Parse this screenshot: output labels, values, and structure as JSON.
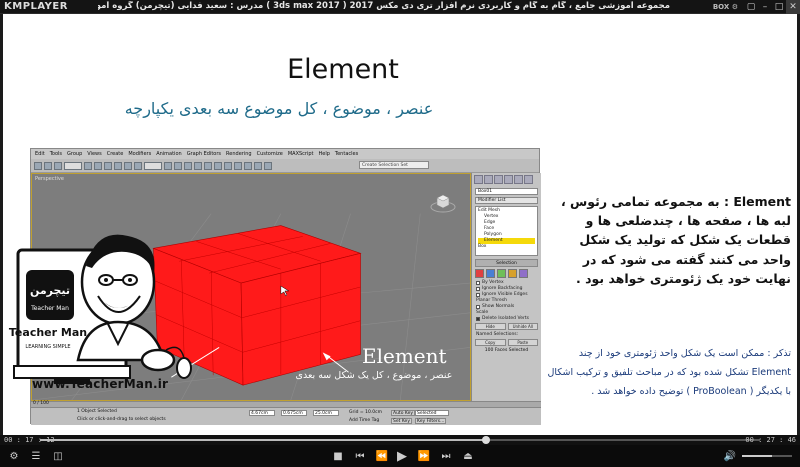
{
  "player": {
    "logo": "KMPLAYER",
    "title": "مجموعه آموزشی جامع ، گام به گام و کاربردی نرم افزار تری دی مکس 2017  ( 3ds max 2017 )  مدرس : سعید فدایی (تیچرمن) گروه آموزشی پادشاه گرافیست ها",
    "box_label": "BOX ⚙",
    "time_current": "00 : 17 : 12",
    "time_total": "00 : 27 : 46",
    "progress_fraction": 0.62,
    "volume_fraction": 0.6
  },
  "slide": {
    "title": "Element",
    "subtitle": "عنصر ، موضوع ، کل موضوع سه بعدی یکپارچه",
    "paragraph_main": "Element : به مجموعه تمامی رئوس ، لبه ها ، صفحه ها ، چندضلعی ها و قطعات یک شکل که تولید یک شکل واحد می کنند گفته می شود که در نهایت خود یک ژئومتری خواهد بود .",
    "paragraph_note": "تذکر : ممکن است یک شکل واحد ژئومتری خود از چند Element تشکل شده بود که در مباحث تلفیق و ترکیب اشکال با یکدیگر ( ProBoolean ) توضیح داده خواهد شد .",
    "overlay_label": "Element",
    "overlay_sub": "عنصر ، موضوع ، کل یک شکل سه بعدی",
    "website": "www.TeacherMan.ir"
  },
  "max": {
    "menu": [
      "Edit",
      "Tools",
      "Group",
      "Views",
      "Create",
      "Modifiers",
      "Animation",
      "Graph Editors",
      "Rendering",
      "Customize",
      "MAXScript",
      "Help",
      "Tentacles"
    ],
    "search_placeholder": "Create Selection Set",
    "viewport_label": "Perspective",
    "object_name": "Box01",
    "modifier_list": "Modifier List",
    "stack": [
      "Edit Mesh",
      "Vertex",
      "Edge",
      "Face",
      "Polygon",
      "Element",
      "Box"
    ],
    "selected_stack_item": "Element",
    "selection_rollout": "Selection",
    "checks": [
      "By Vertex",
      "Ignore Backfacing",
      "Ignore Visible Edges",
      "Planar Thresh",
      "Show Normals",
      "Scale",
      "Delete Isolated Verts"
    ],
    "hide_buttons": [
      "Hide",
      "Unhide All"
    ],
    "named_sel": "Named Selections:",
    "copy_paste": [
      "Copy",
      "Paste"
    ],
    "faces_selected": "100 Faces Selected",
    "timeline": "0 / 100",
    "status_selected": "1 Object Selected",
    "status_hint": "Click or click-and-drag to select objects",
    "coord_x": "4.67cm",
    "coord_y": "0.675cm",
    "coord_z": "25.0cm",
    "grid": "Grid = 10.0cm",
    "auto_key": "Auto Key",
    "set_key": "Set Key",
    "selected": "Selected",
    "key_filters": "Key Filters...",
    "add_time_tag": "Add Time Tag"
  },
  "colors": {
    "subtitle": "#1f6b8a",
    "element_box": "#ff1a1a",
    "note_text": "#1a3a7a"
  }
}
